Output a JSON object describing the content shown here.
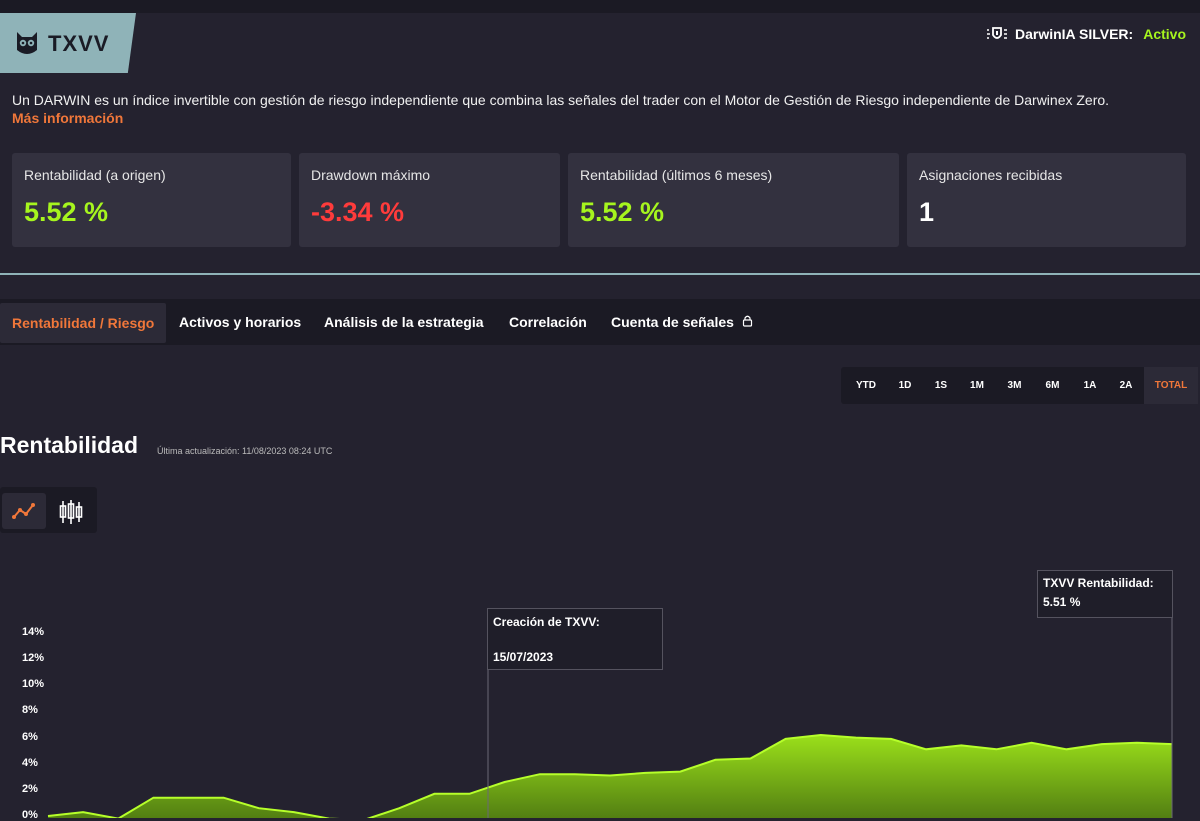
{
  "header": {
    "ticker": "TXVV",
    "silver_label": "DarwinIA SILVER:",
    "silver_status": "Activo"
  },
  "description": "Un DARWIN es un índice invertible con gestión de riesgo independiente que combina las señales del trader con el Motor de Gestión de Riesgo independiente de Darwinex Zero.",
  "more_info": "Más información",
  "stats": [
    {
      "label": "Rentabilidad (a origen)",
      "value": "5.52 %"
    },
    {
      "label": "Drawdown máximo",
      "value": "-3.34 %"
    },
    {
      "label": "Rentabilidad (últimos 6 meses)",
      "value": "5.52 %"
    },
    {
      "label": "Asignaciones recibidas",
      "value": "1"
    }
  ],
  "tabs": [
    "Rentabilidad / Riesgo",
    "Activos y horarios",
    "Análisis de la estrategia",
    "Correlación",
    "Cuenta de señales"
  ],
  "periods": [
    "YTD",
    "1D",
    "1S",
    "1M",
    "3M",
    "6M",
    "1A",
    "2A",
    "TOTAL"
  ],
  "section": {
    "title": "Rentabilidad",
    "updated": "Última actualización: 11/08/2023 08:24 UTC"
  },
  "icons": {
    "line_chart": "line-chart-icon",
    "candles": "candlestick-icon",
    "lock": "lock-icon",
    "owl": "owl-logo-icon",
    "shield": "shield-icon"
  },
  "colors": {
    "accent": "#f0773a",
    "positive": "#a6f51e",
    "negative": "#ff3b3b",
    "background": "#24222f",
    "panel": "#33313f"
  },
  "annotations": {
    "creation_title": "Creación de TXVV:",
    "creation_date": "15/07/2023",
    "current_title": "TXVV Rentabilidad:",
    "current_value": "5.51 %"
  },
  "chart_data": {
    "type": "area",
    "y_tick_labels": [
      "14%",
      "12%",
      "10%",
      "8%",
      "6%",
      "4%",
      "2%",
      "0%"
    ],
    "ylim": [
      0,
      14
    ],
    "series": [
      {
        "values": [
          0.0,
          0.3,
          -0.2,
          1.4,
          1.4,
          1.4,
          0.6,
          0.3,
          -0.2,
          -0.3,
          0.6,
          1.7,
          1.7,
          2.6,
          3.2,
          3.2,
          3.1,
          3.3,
          3.4,
          4.3,
          4.4,
          5.9,
          6.2,
          6.0,
          5.9,
          5.1,
          5.4,
          5.1,
          5.6,
          5.1,
          5.5,
          5.6,
          5.5
        ]
      }
    ]
  }
}
